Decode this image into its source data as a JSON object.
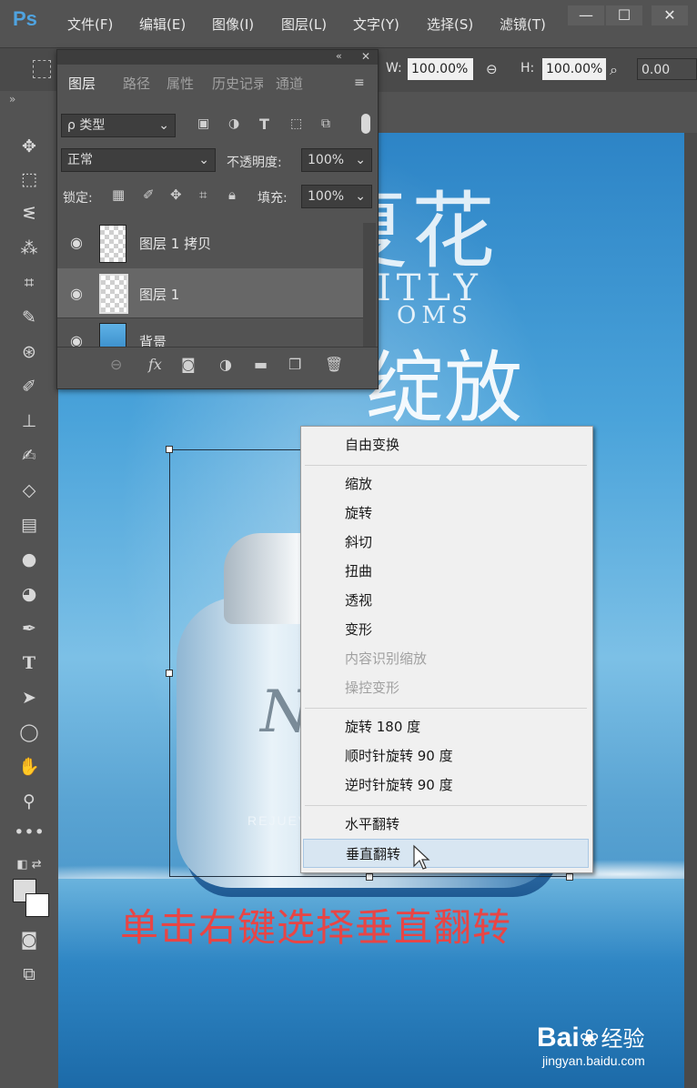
{
  "app": {
    "logo": "Ps",
    "menu": [
      "文件(F)",
      "编辑(E)",
      "图像(I)",
      "图层(L)",
      "文字(Y)",
      "选择(S)",
      "滤镜(T)"
    ],
    "window_buttons": [
      "—",
      "☐",
      "✕"
    ]
  },
  "options_bar": {
    "w_label": "W:",
    "w_value": "100.00%",
    "h_label": "H:",
    "h_value": "100.00%",
    "rotate_value": "0.00"
  },
  "layers_panel": {
    "tabs": [
      "图层",
      "路径",
      "属性",
      "历史记录",
      "通道"
    ],
    "filter_label": "ρ 类型",
    "blend_mode": "正常",
    "opacity_label": "不透明度:",
    "opacity_value": "100%",
    "lock_label": "锁定:",
    "fill_label": "填充:",
    "fill_value": "100%",
    "layers": [
      {
        "name": "图层 1 拷贝",
        "visible": true,
        "selected": false
      },
      {
        "name": "图层 1",
        "visible": true,
        "selected": true
      },
      {
        "name": "背景",
        "visible": true,
        "selected": false
      }
    ]
  },
  "canvas": {
    "title_top": "夏花",
    "title_en_1": "ITLY",
    "title_en_2": "OMS",
    "title_bottom": "绽放",
    "jar_letter": "N",
    "jar_brand": "REJUEVIN"
  },
  "context_menu": {
    "items": [
      {
        "label": "自由变换",
        "disabled": false,
        "separator_after": true
      },
      {
        "label": "缩放",
        "disabled": false,
        "separator_after": false
      },
      {
        "label": "旋转",
        "disabled": false,
        "separator_after": false
      },
      {
        "label": "斜切",
        "disabled": false,
        "separator_after": false
      },
      {
        "label": "扭曲",
        "disabled": false,
        "separator_after": false
      },
      {
        "label": "透视",
        "disabled": false,
        "separator_after": false
      },
      {
        "label": "变形",
        "disabled": false,
        "separator_after": false
      },
      {
        "label": "内容识别缩放",
        "disabled": true,
        "separator_after": false
      },
      {
        "label": "操控变形",
        "disabled": true,
        "separator_after": true
      },
      {
        "label": "旋转 180 度",
        "disabled": false,
        "separator_after": false
      },
      {
        "label": "顺时针旋转 90 度",
        "disabled": false,
        "separator_after": false
      },
      {
        "label": "逆时针旋转 90 度",
        "disabled": false,
        "separator_after": true
      },
      {
        "label": "水平翻转",
        "disabled": false,
        "separator_after": false
      },
      {
        "label": "垂直翻转",
        "disabled": false,
        "separator_after": false,
        "hovered": true
      }
    ]
  },
  "instruction": "单击右键选择垂直翻转",
  "watermark": {
    "brand": "Bai",
    "brand2": "经验",
    "url": "jingyan.baidu.com"
  },
  "colors": {
    "accent": "#4fa3e0",
    "instruction": "#e84545",
    "menu_bg": "#f0f0f0"
  }
}
